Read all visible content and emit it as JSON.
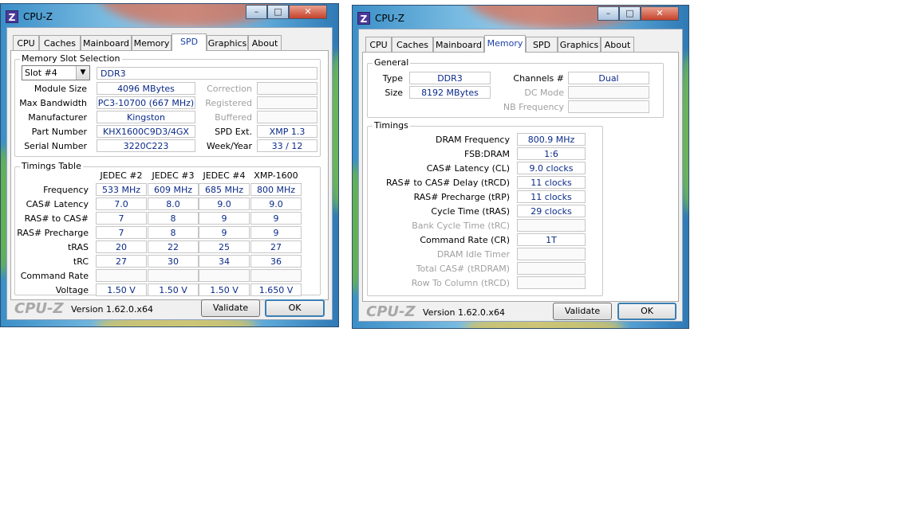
{
  "left_window": {
    "app_icon": "Z",
    "title": "CPU-Z",
    "controls": {
      "minimize": "–",
      "maximize": "□",
      "close": "✕"
    },
    "tabs": [
      {
        "label": "CPU"
      },
      {
        "label": "Caches"
      },
      {
        "label": "Mainboard"
      },
      {
        "label": "Memory"
      },
      {
        "label": "SPD",
        "active": true
      },
      {
        "label": "Graphics"
      },
      {
        "label": "About"
      }
    ],
    "slot_group": {
      "title": "Memory Slot Selection",
      "slot_selected": "Slot #4",
      "slot_type": "DDR3",
      "rows": [
        {
          "label": "Module Size",
          "value": "4096 MBytes",
          "right_label": "Correction",
          "right_value": ""
        },
        {
          "label": "Max Bandwidth",
          "value": "PC3-10700 (667 MHz)",
          "right_label": "Registered",
          "right_value": ""
        },
        {
          "label": "Manufacturer",
          "value": "Kingston",
          "right_label": "Buffered",
          "right_value": ""
        },
        {
          "label": "Part Number",
          "value": "KHX1600C9D3/4GX",
          "right_label": "SPD Ext.",
          "right_value": "XMP 1.3"
        },
        {
          "label": "Serial Number",
          "value": "3220C223",
          "right_label": "Week/Year",
          "right_value": "33 / 12"
        }
      ]
    },
    "timings_group": {
      "title": "Timings Table",
      "columns": [
        "JEDEC #2",
        "JEDEC #3",
        "JEDEC #4",
        "XMP-1600"
      ],
      "rows": [
        {
          "label": "Frequency",
          "values": [
            "533 MHz",
            "609 MHz",
            "685 MHz",
            "800 MHz"
          ]
        },
        {
          "label": "CAS# Latency",
          "values": [
            "7.0",
            "8.0",
            "9.0",
            "9.0"
          ]
        },
        {
          "label": "RAS# to CAS#",
          "values": [
            "7",
            "8",
            "9",
            "9"
          ]
        },
        {
          "label": "RAS# Precharge",
          "values": [
            "7",
            "8",
            "9",
            "9"
          ]
        },
        {
          "label": "tRAS",
          "values": [
            "20",
            "22",
            "25",
            "27"
          ]
        },
        {
          "label": "tRC",
          "values": [
            "27",
            "30",
            "34",
            "36"
          ]
        },
        {
          "label": "Command Rate",
          "values": [
            "",
            "",
            "",
            ""
          ]
        },
        {
          "label": "Voltage",
          "values": [
            "1.50 V",
            "1.50 V",
            "1.50 V",
            "1.650 V"
          ]
        }
      ]
    },
    "footer": {
      "logo": "CPU-Z",
      "version": "Version 1.62.0.x64",
      "validate": "Validate",
      "ok": "OK"
    }
  },
  "right_window": {
    "app_icon": "Z",
    "title": "CPU-Z",
    "controls": {
      "minimize": "–",
      "maximize": "□",
      "close": "✕"
    },
    "tabs": [
      {
        "label": "CPU"
      },
      {
        "label": "Caches"
      },
      {
        "label": "Mainboard"
      },
      {
        "label": "Memory",
        "active": true
      },
      {
        "label": "SPD"
      },
      {
        "label": "Graphics"
      },
      {
        "label": "About"
      }
    ],
    "general": {
      "title": "General",
      "type_label": "Type",
      "type_value": "DDR3",
      "size_label": "Size",
      "size_value": "8192 MBytes",
      "channels_label": "Channels #",
      "channels_value": "Dual",
      "dc_mode_label": "DC Mode",
      "dc_mode_value": "",
      "nb_freq_label": "NB Frequency",
      "nb_freq_value": ""
    },
    "timings": {
      "title": "Timings",
      "rows": [
        {
          "label": "DRAM Frequency",
          "value": "800.9 MHz",
          "enabled": true
        },
        {
          "label": "FSB:DRAM",
          "value": "1:6",
          "enabled": true
        },
        {
          "label": "CAS# Latency (CL)",
          "value": "9.0 clocks",
          "enabled": true
        },
        {
          "label": "RAS# to CAS# Delay (tRCD)",
          "value": "11 clocks",
          "enabled": true
        },
        {
          "label": "RAS# Precharge (tRP)",
          "value": "11 clocks",
          "enabled": true
        },
        {
          "label": "Cycle Time (tRAS)",
          "value": "29 clocks",
          "enabled": true
        },
        {
          "label": "Bank Cycle Time (tRC)",
          "value": "",
          "enabled": false
        },
        {
          "label": "Command Rate (CR)",
          "value": "1T",
          "enabled": true
        },
        {
          "label": "DRAM Idle Timer",
          "value": "",
          "enabled": false
        },
        {
          "label": "Total CAS# (tRDRAM)",
          "value": "",
          "enabled": false
        },
        {
          "label": "Row To Column (tRCD)",
          "value": "",
          "enabled": false
        }
      ]
    },
    "footer": {
      "logo": "CPU-Z",
      "version": "Version 1.62.0.x64",
      "validate": "Validate",
      "ok": "OK"
    }
  }
}
